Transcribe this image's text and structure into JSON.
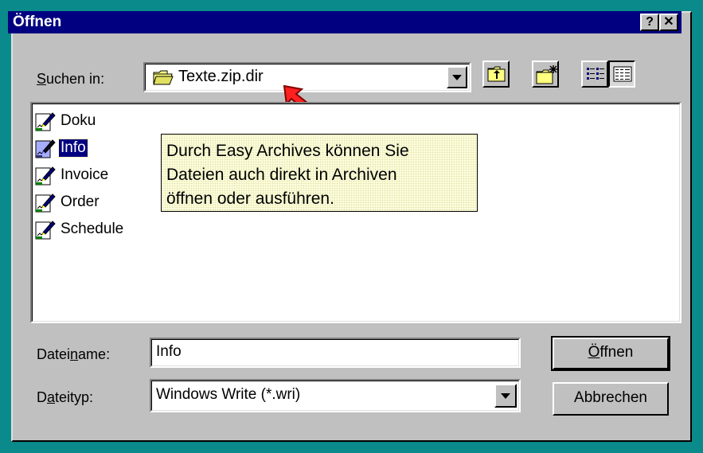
{
  "window": {
    "title": "Öffnen",
    "help_button": "?",
    "close_button": "✕"
  },
  "look_in": {
    "label_underlined": "S",
    "label_rest": "uchen in:",
    "value": "Texte.zip.dir"
  },
  "toolbar": {
    "up_folder": "up-one-level",
    "new_folder": "create-new-folder",
    "list_view": "list",
    "details_view": "details"
  },
  "files": [
    {
      "name": "Doku",
      "selected": false
    },
    {
      "name": "Info",
      "selected": true
    },
    {
      "name": "Invoice",
      "selected": false
    },
    {
      "name": "Order",
      "selected": false
    },
    {
      "name": "Schedule",
      "selected": false
    }
  ],
  "tooltip": {
    "lines": [
      "Durch Easy Archives können Sie",
      "Dateien auch direkt in Archiven",
      "öffnen oder ausführen."
    ]
  },
  "filename": {
    "label_before": "Datei",
    "label_underlined": "n",
    "label_after": "ame:",
    "value": "Info"
  },
  "filetype": {
    "label_before": "D",
    "label_underlined": "a",
    "label_after": "teityp:",
    "value": "Windows Write (*.wri)"
  },
  "buttons": {
    "open_underlined": "Ö",
    "open_rest": "ffnen",
    "cancel": "Abbrechen"
  },
  "colors": {
    "desktop": "#0a8a8a",
    "titlebar": "#000080",
    "face": "#c0c0c0",
    "tooltip_bg": "#ffffe1",
    "arrow": "#ff2020"
  }
}
